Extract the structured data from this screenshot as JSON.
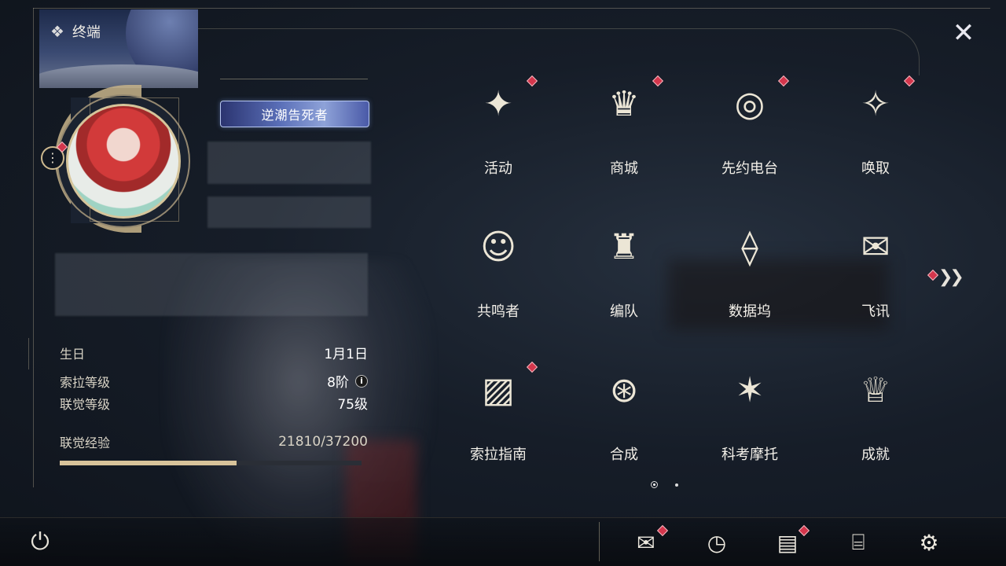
{
  "header": {
    "title": "终端",
    "title_icon": "diamond-cluster-icon",
    "close_icon": "close-star-icon"
  },
  "profile": {
    "title_badge": "逆潮告死者",
    "more_icon": "more-vertical-icon",
    "stats": [
      {
        "label": "生日",
        "value": "1月1日"
      },
      {
        "label": "索拉等级",
        "value": "8阶",
        "info": "i"
      },
      {
        "label": "联觉等级",
        "value": "75级"
      },
      {
        "label": "联觉经验",
        "value": "21810/37200"
      }
    ],
    "exp_progress": 0.586
  },
  "grid": {
    "items": [
      {
        "label": "活动",
        "icon": "activity-sparkle-icon",
        "glyph": "✦",
        "badge": true
      },
      {
        "label": "商城",
        "icon": "shop-cart-icon",
        "glyph": "♛",
        "badge": true
      },
      {
        "label": "先约电台",
        "icon": "radio-turntable-icon",
        "glyph": "◎",
        "badge": true
      },
      {
        "label": "唤取",
        "icon": "summon-compass-icon",
        "glyph": "✧",
        "badge": true
      },
      {
        "label": "共鸣者",
        "icon": "resonator-portrait-icon",
        "glyph": "☺",
        "badge": false
      },
      {
        "label": "编队",
        "icon": "team-chess-icon",
        "glyph": "♜",
        "badge": false
      },
      {
        "label": "数据坞",
        "icon": "data-dock-icon",
        "glyph": "⟠",
        "badge": false
      },
      {
        "label": "飞讯",
        "icon": "message-bubble-icon",
        "glyph": "✉",
        "badge": false
      },
      {
        "label": "索拉指南",
        "icon": "guide-book-icon",
        "glyph": "▨",
        "badge": true
      },
      {
        "label": "合成",
        "icon": "synthesis-orbit-icon",
        "glyph": "⊛",
        "badge": false
      },
      {
        "label": "科考摩托",
        "icon": "motorcycle-icon",
        "glyph": "✶",
        "badge": false
      },
      {
        "label": "成就",
        "icon": "trophy-icon",
        "glyph": "♕",
        "badge": false
      }
    ],
    "next_page_icon": "double-chevron-right-icon",
    "page_count": 2,
    "current_page": 1
  },
  "bottom_bar": {
    "power_icon": "power-icon",
    "icons": [
      {
        "name": "mail-icon",
        "glyph": "✉",
        "badge": true
      },
      {
        "name": "clock-icon",
        "glyph": "◷",
        "badge": false
      },
      {
        "name": "notice-icon",
        "glyph": "▤",
        "badge": true
      },
      {
        "name": "camera-icon",
        "glyph": "⌸",
        "badge": false
      },
      {
        "name": "settings-gear-icon",
        "glyph": "⚙",
        "badge": false
      }
    ]
  },
  "colors": {
    "accent_gold": "#c8b48a",
    "badge_red": "#d4364c",
    "exp_fill": "#d8c39a",
    "background": "#161d28"
  }
}
